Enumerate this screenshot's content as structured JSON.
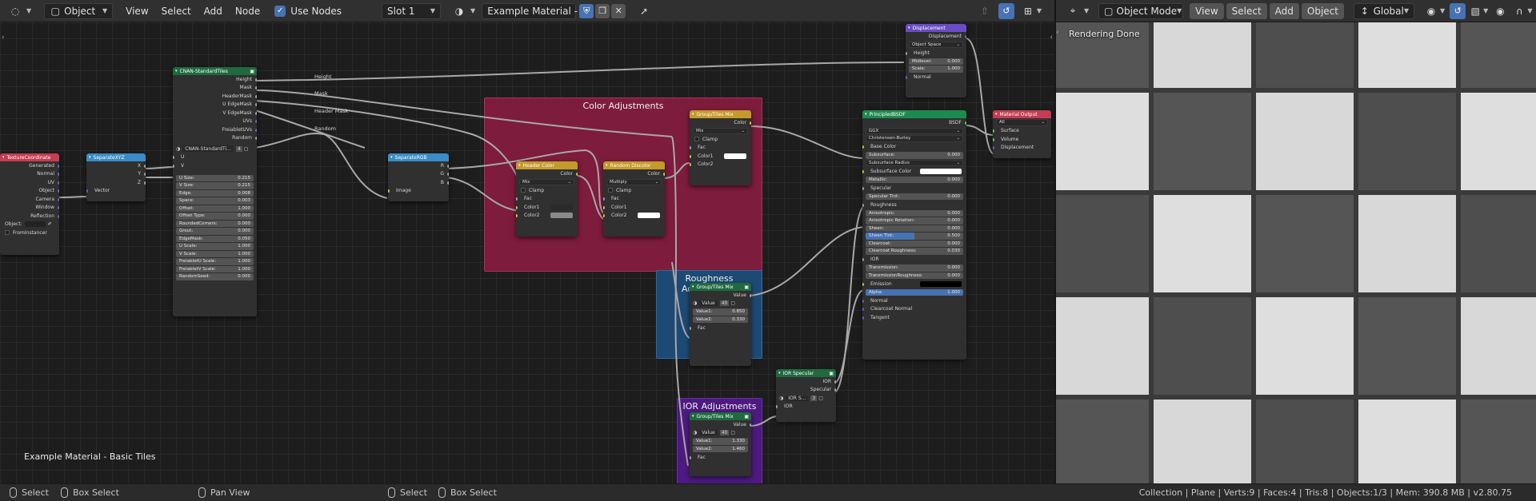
{
  "left_header": {
    "object_label": "Object",
    "menus": [
      "View",
      "Select",
      "Add",
      "Node"
    ],
    "use_nodes_label": "Use Nodes",
    "slot_label": "Slot 1",
    "material_name": "Example Material - ...",
    "pin_icon": "pin-icon"
  },
  "right_header": {
    "mode_label": "Object Mode",
    "menus": [
      "View",
      "Select",
      "Add",
      "Object"
    ],
    "orientation_label": "Global"
  },
  "node_editor": {
    "caption": "Example Material - Basic Tiles",
    "frames": {
      "color": {
        "title": "Color Adjustments",
        "color": "#7d1c3d"
      },
      "roughness": {
        "title": "Roughness Adjustments",
        "color": "#1d4a74"
      },
      "ior": {
        "title": "IOR Adjustments",
        "color": "#4d1a80"
      }
    },
    "wire_labels": [
      "Height",
      "Mask",
      "Header Mask",
      "Random"
    ],
    "nodes": {
      "texcoord": {
        "title": "TextureCoordinate",
        "outputs": [
          "Generated",
          "Normal",
          "UV",
          "Object",
          "Camera",
          "Window",
          "Reflection"
        ],
        "object_label": "Object:",
        "from_instancer": "FromInstancer"
      },
      "sepxyz": {
        "title": "SeparateXYZ",
        "outputs": [
          "X",
          "Y",
          "Z"
        ],
        "input": "Vector"
      },
      "tiles": {
        "title": "CNAN-StandardTiles",
        "outputs": [
          "Height",
          "Mask",
          "HeaderMask",
          "U EdgeMask",
          "V EdgeMask",
          "UVs",
          "FreiabletUVs",
          "Random"
        ],
        "group_name": "CNAN-StandardTi...",
        "users": "4",
        "inputs_uv": [
          "U",
          "V"
        ],
        "fields": [
          {
            "label": "U Size:",
            "value": "0.215"
          },
          {
            "label": "V Size:",
            "value": "0.215"
          },
          {
            "label": "Edge:",
            "value": "0.008"
          },
          {
            "label": "Space:",
            "value": "0.003"
          },
          {
            "label": "Offset:",
            "value": "1.000"
          },
          {
            "label": "Offset Type:",
            "value": "0.000"
          },
          {
            "label": "RoundedCorners:",
            "value": "0.000"
          },
          {
            "label": "Grout:",
            "value": "0.000"
          },
          {
            "label": "EdgeMask:",
            "value": "0.050"
          },
          {
            "label": "U Scale:",
            "value": "1.000"
          },
          {
            "label": "V Scale:",
            "value": "1.000"
          },
          {
            "label": "FreiabletU Scale:",
            "value": "1.000"
          },
          {
            "label": "FreiabletV Scale:",
            "value": "1.000"
          },
          {
            "label": "RandomSeed:",
            "value": "0.000"
          }
        ]
      },
      "seprgb": {
        "title": "SeparateRGB",
        "outputs": [
          "R",
          "G",
          "B"
        ],
        "input": "Image"
      },
      "headercolor": {
        "title": "Header Color",
        "output": "Color",
        "blend": "Mix",
        "clamp": "Clamp",
        "inputs": [
          "Fac",
          "Color1",
          "Color2"
        ],
        "color1": "#2a2a2a",
        "color2": "#8a8a8a"
      },
      "randomdiscolor": {
        "title": "Random Discolor",
        "output": "Color",
        "blend": "Multiply",
        "clamp": "Clamp",
        "inputs": [
          "Fac",
          "Color1",
          "Color2"
        ],
        "color2": "#ffffff"
      },
      "tilesmix1": {
        "title": "Group/Tiles Mix",
        "output": "Color",
        "blend": "Mix",
        "clamp": "Clamp",
        "inputs": [
          "Fac",
          "Color1",
          "Color2"
        ],
        "color1": "#ffffff"
      },
      "tilesmix2": {
        "title": "Group/Tiles Mix",
        "output": "Value",
        "group": "Value",
        "users": "40",
        "fields": [
          {
            "label": "Value1:",
            "value": "0.850"
          },
          {
            "label": "Value2:",
            "value": "0.330"
          }
        ],
        "fac": "Fac"
      },
      "tilesmix3": {
        "title": "Group/Tiles Mix",
        "output": "Value",
        "group": "Value",
        "users": "40",
        "fields": [
          {
            "label": "Value1:",
            "value": "1.330"
          },
          {
            "label": "Value2:",
            "value": "1.460"
          }
        ],
        "fac": "Fac"
      },
      "iorspec": {
        "title": "IOR Specular",
        "outputs": [
          "IOR",
          "Specular"
        ],
        "group": "IOR S...",
        "users": "3",
        "input": "IOR"
      },
      "displacement": {
        "title": "Displacement",
        "output": "Displacement",
        "space": "Object Space",
        "inputs": [
          "Height"
        ],
        "fields": [
          {
            "label": "Midlevel:",
            "value": "0.000"
          },
          {
            "label": "Scale:",
            "value": "1.000"
          }
        ],
        "normal": "Normal"
      },
      "bsdf": {
        "title": "PrincipledBSDF",
        "output": "BSDF",
        "dist": "GGX",
        "sss": "Christensen-Burley",
        "base_color": "Base Color",
        "fields1": [
          {
            "label": "Subsurface:",
            "value": "0.000"
          }
        ],
        "subsurface_radius": "Subsurface Radius",
        "subsurface_color": "Subsurface Color",
        "fields2": [
          {
            "label": "Metallic:",
            "value": "0.000"
          }
        ],
        "specular": "Specular",
        "fields3": [
          {
            "label": "Specular Tint:",
            "value": "0.000"
          }
        ],
        "roughness": "Roughness",
        "fields4": [
          {
            "label": "Anisotropic:",
            "value": "0.000"
          },
          {
            "label": "Anisotropic Rotation:",
            "value": "0.000"
          },
          {
            "label": "Sheen:",
            "value": "0.000"
          },
          {
            "label": "Sheen Tint:",
            "value": "0.500"
          },
          {
            "label": "Clearcoat:",
            "value": "0.000"
          },
          {
            "label": "Clearcoat Roughness:",
            "value": "0.030"
          }
        ],
        "ior": "IOR",
        "fields5": [
          {
            "label": "Transmission:",
            "value": "0.000"
          },
          {
            "label": "TransmissionRoughness:",
            "value": "0.000"
          }
        ],
        "emission": "Emission",
        "alpha": {
          "label": "Alpha:",
          "value": "1.000"
        },
        "tail": [
          "Normal",
          "Clearcoat Normal",
          "Tangent"
        ]
      },
      "output": {
        "title": "Material Output",
        "target": "All",
        "inputs": [
          "Surface",
          "Volume",
          "Displacement"
        ]
      }
    }
  },
  "viewport": {
    "status": "Rendering Done"
  },
  "status_bar": {
    "items": [
      "Select",
      "Box Select",
      "Pan View",
      "Select",
      "Box Select"
    ],
    "stats": "Collection | Plane | Verts:9 | Faces:4 | Tris:8 | Objects:1/3 | Mem: 390.8 MB | v2.80.75"
  }
}
